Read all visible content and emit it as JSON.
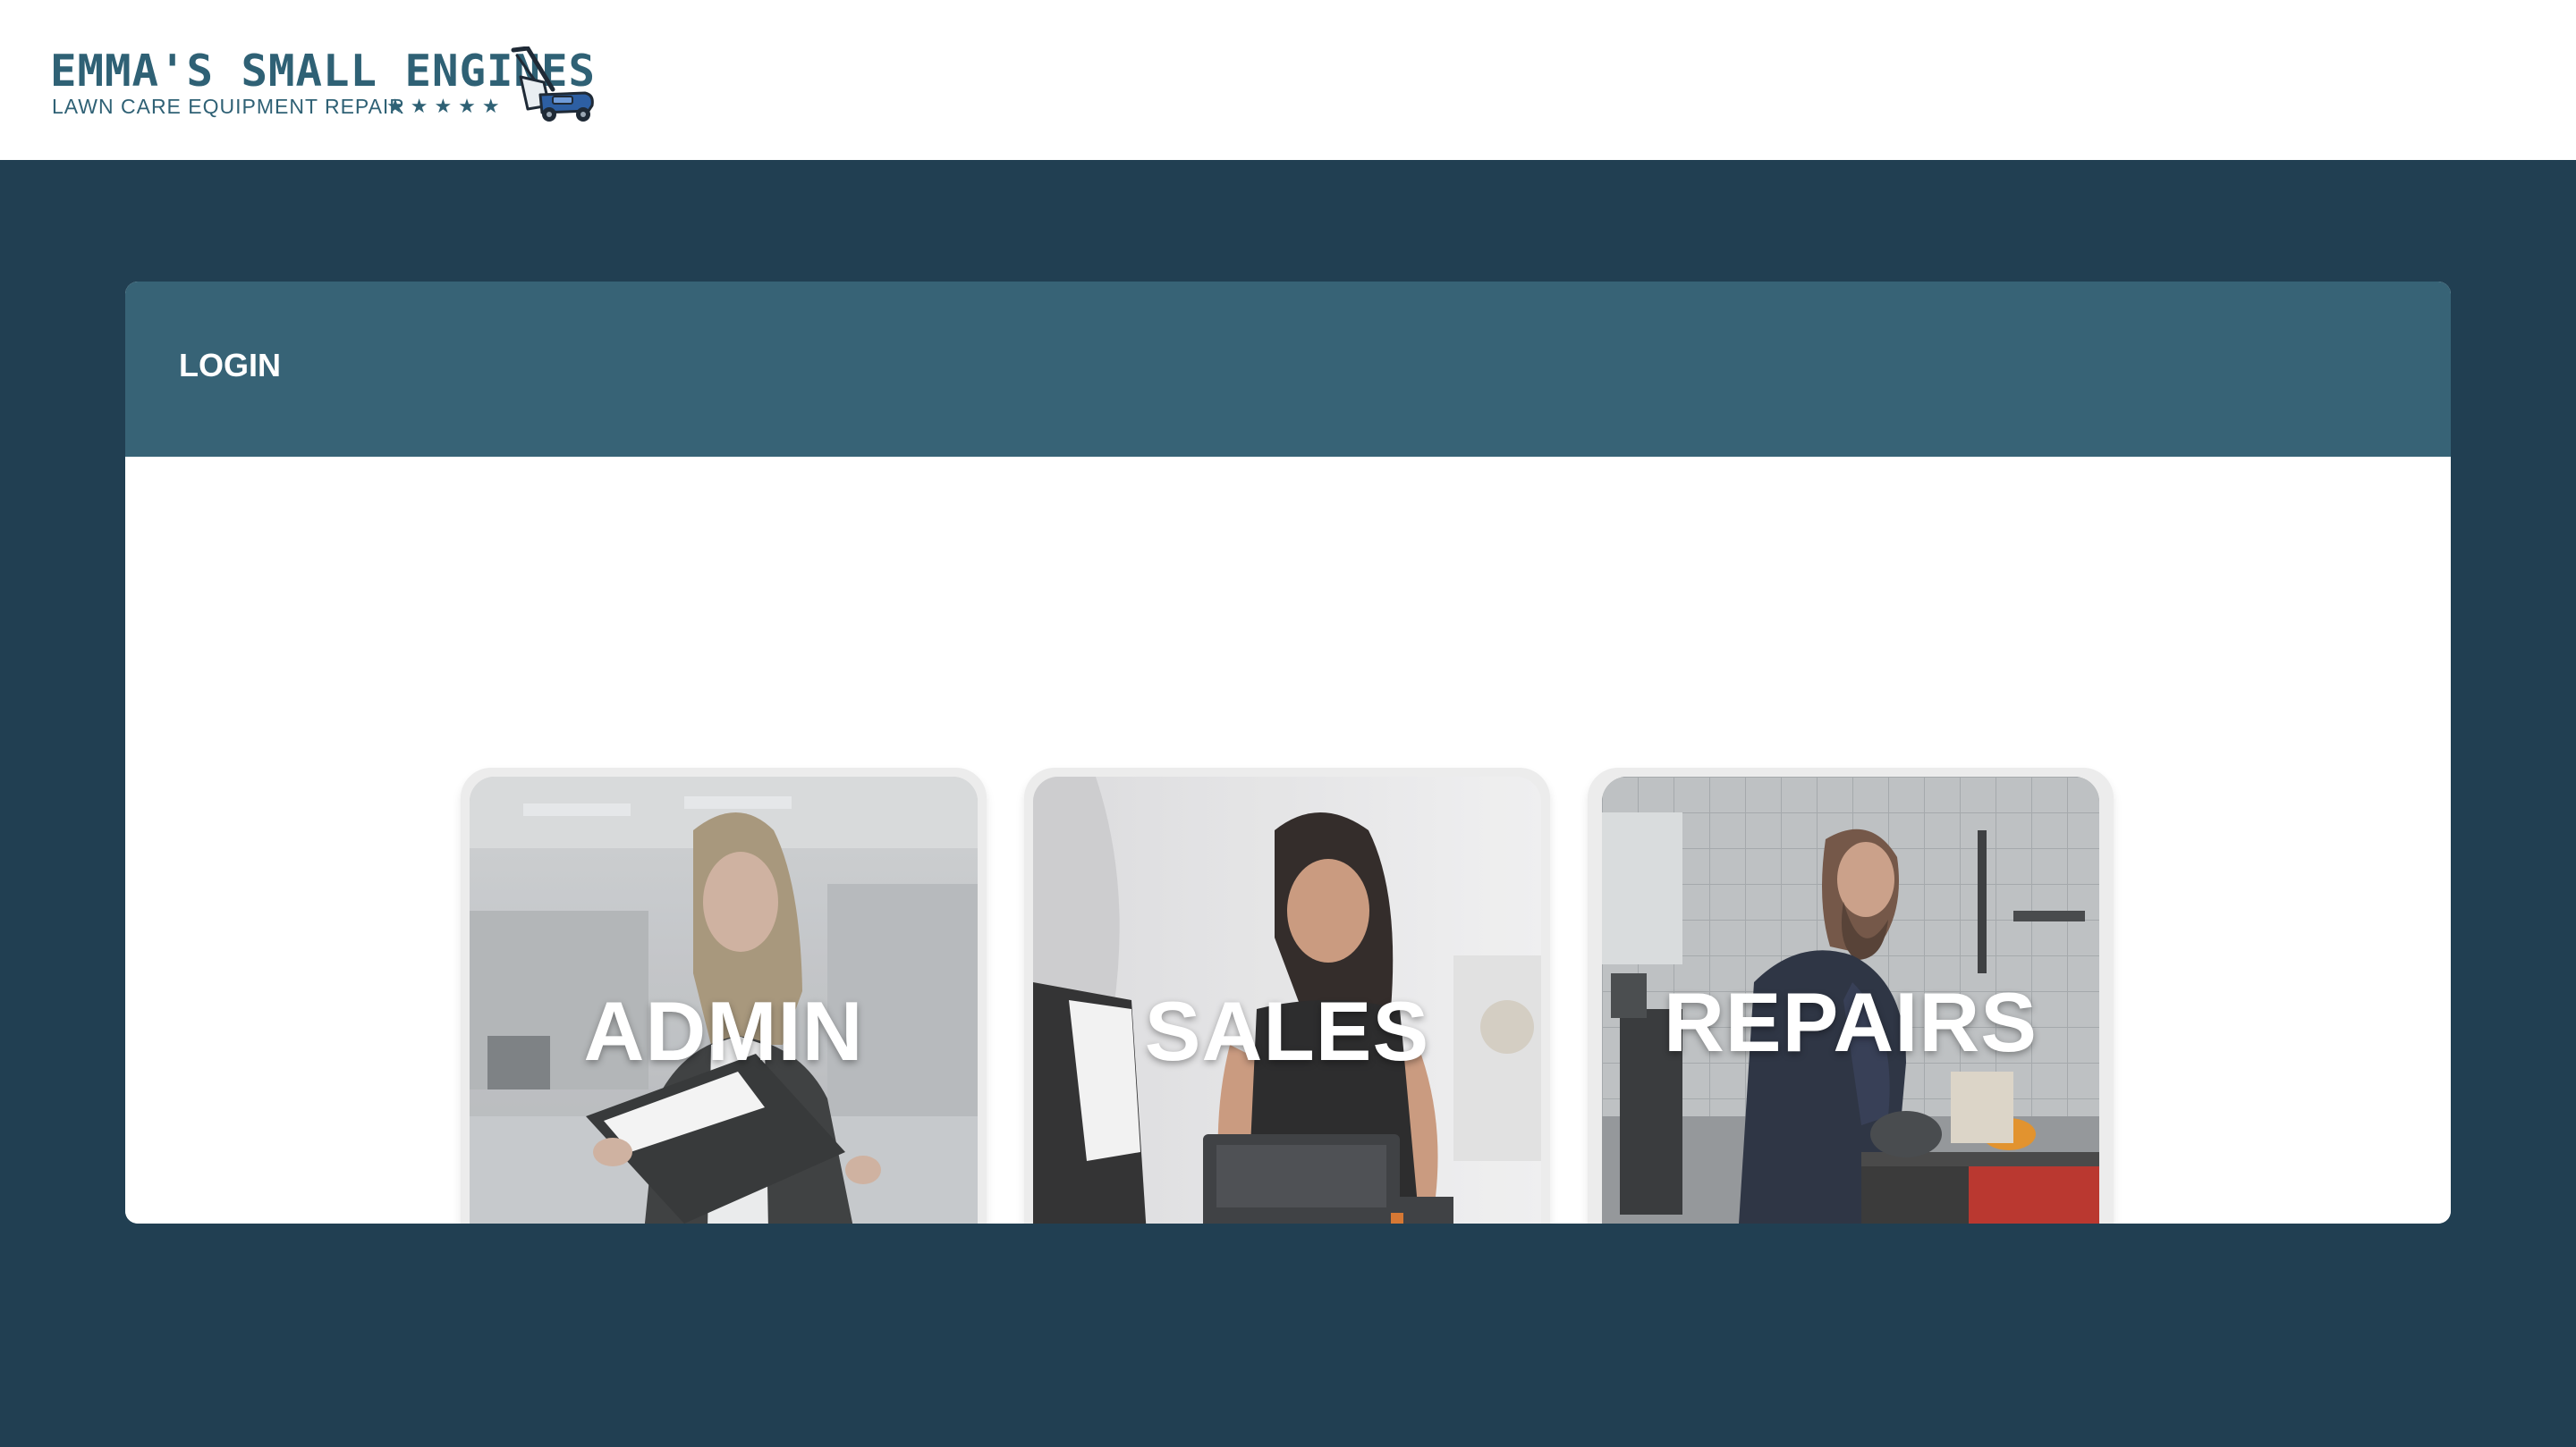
{
  "header": {
    "logo": {
      "title": "EMMA'S SMALL ENGINES",
      "subtitle": "LAWN CARE EQUIPMENT REPAIR",
      "stars": "★★★★★",
      "icon": "lawn-mower-icon"
    }
  },
  "login": {
    "title": "LOGIN",
    "cards": [
      {
        "label": "ADMIN"
      },
      {
        "label": "SALES"
      },
      {
        "label": "REPAIRS"
      }
    ]
  },
  "colors": {
    "page_background": "#213f52",
    "panel_header": "#376376",
    "brand_text": "#2f6175",
    "card_frame": "#ececec",
    "label_text": "#ffffff"
  }
}
